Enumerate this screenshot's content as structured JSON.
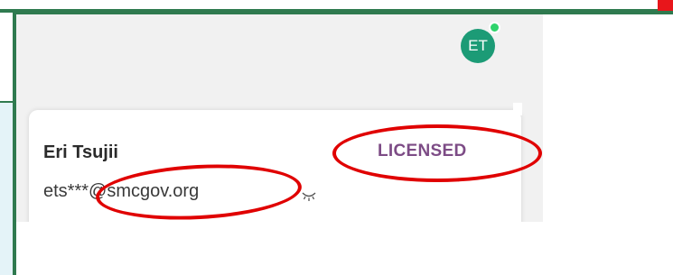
{
  "header": {
    "avatar_initials": "ET",
    "presence_color": "#2fd36b"
  },
  "card": {
    "name": "Eri Tsujii",
    "email_masked": "ets***@smcgov.org",
    "license_status": "LICENSED"
  },
  "icons": {
    "reveal": "eye-closed-icon"
  },
  "colors": {
    "frame_green": "#2f7a4f",
    "annotation_red": "#e00000",
    "avatar_bg": "#1c9b76",
    "licensed_text": "#7d4c86"
  }
}
